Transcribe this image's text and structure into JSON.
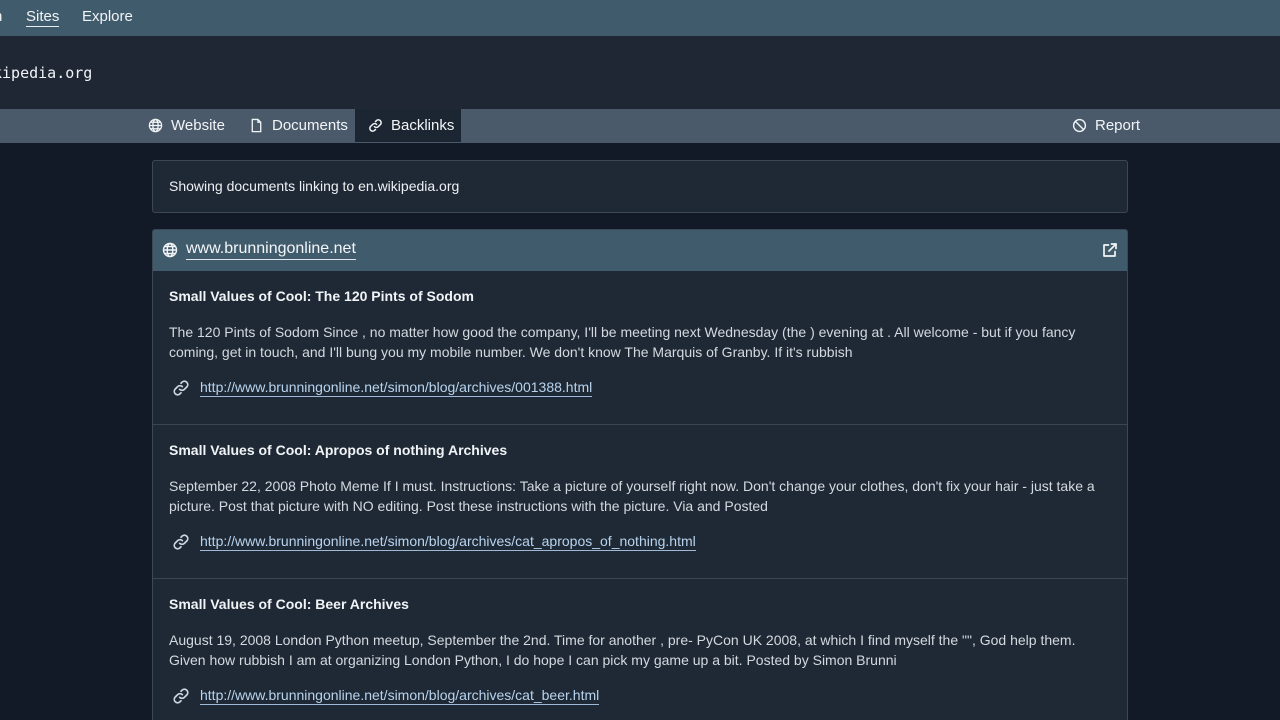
{
  "topnav": {
    "clipped_item": "n",
    "sites": "Sites",
    "explore": "Explore"
  },
  "domain": {
    "title": "kipedia.org"
  },
  "tabs": {
    "website": "Website",
    "documents": "Documents",
    "backlinks": "Backlinks",
    "report": "Report",
    "active": "backlinks"
  },
  "info": {
    "text": "Showing documents linking to en.wikipedia.org"
  },
  "site": {
    "name": "www.brunningonline.net"
  },
  "entries": [
    {
      "title": "Small Values of Cool: The 120 Pints of Sodom",
      "snippet": "The 120 Pints of Sodom Since , no matter how good the company, I'll be meeting next Wednesday (the ) evening at . All welcome - but if you fancy coming, get in touch, and I'll bung you my mobile number. We don't know The Marquis of Granby. If it's rubbish",
      "url": "http://www.brunningonline.net/simon/blog/archives/001388.html"
    },
    {
      "title": "Small Values of Cool: Apropos of nothing Archives",
      "snippet": "September 22, 2008 Photo Meme If I must. Instructions: Take a picture of yourself right now. Don't change your clothes, don't fix your hair - just take a picture. Post that picture with NO editing. Post these instructions with the picture. Via and Posted",
      "url": "http://www.brunningonline.net/simon/blog/archives/cat_apropos_of_nothing.html"
    },
    {
      "title": "Small Values of Cool: Beer Archives",
      "snippet": "August 19, 2008 London Python meetup, September the 2nd. Time for another , pre- PyCon UK 2008, at which I find myself the \"\", God help them. Given how rubbish I am at organizing London Python, I do hope I can pick my game up a bit. Posted by Simon Brunni",
      "url": "http://www.brunningonline.net/simon/blog/archives/cat_beer.html"
    }
  ],
  "colors": {
    "nav_bg": "#405b6b",
    "page_bg": "#111a26",
    "panel_bg": "#1f2935",
    "tabbar_bg": "#4a5a6a",
    "link": "#b8d3ee"
  }
}
